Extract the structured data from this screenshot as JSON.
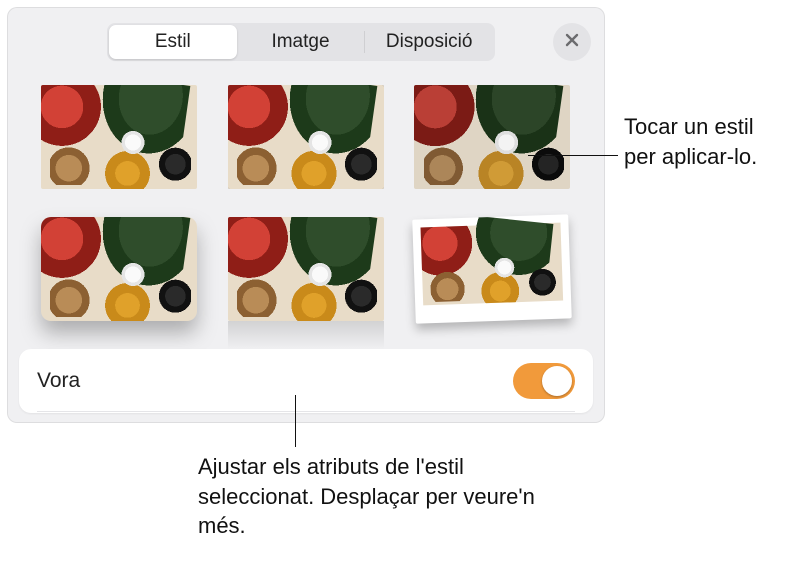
{
  "tabs": {
    "style": "Estil",
    "image": "Imatge",
    "layout": "Disposició"
  },
  "styles_grid": {
    "items": [
      {
        "name": "plain"
      },
      {
        "name": "black-border-selected"
      },
      {
        "name": "desaturated"
      },
      {
        "name": "rounded-shadow"
      },
      {
        "name": "reflection"
      },
      {
        "name": "polaroid"
      }
    ]
  },
  "border_row": {
    "label": "Vora",
    "enabled": true
  },
  "callouts": {
    "top_right": "Tocar un estil per aplicar-lo.",
    "bottom": "Ajustar els atributs de l'estil seleccionat. Desplaçar per veure'n més."
  }
}
